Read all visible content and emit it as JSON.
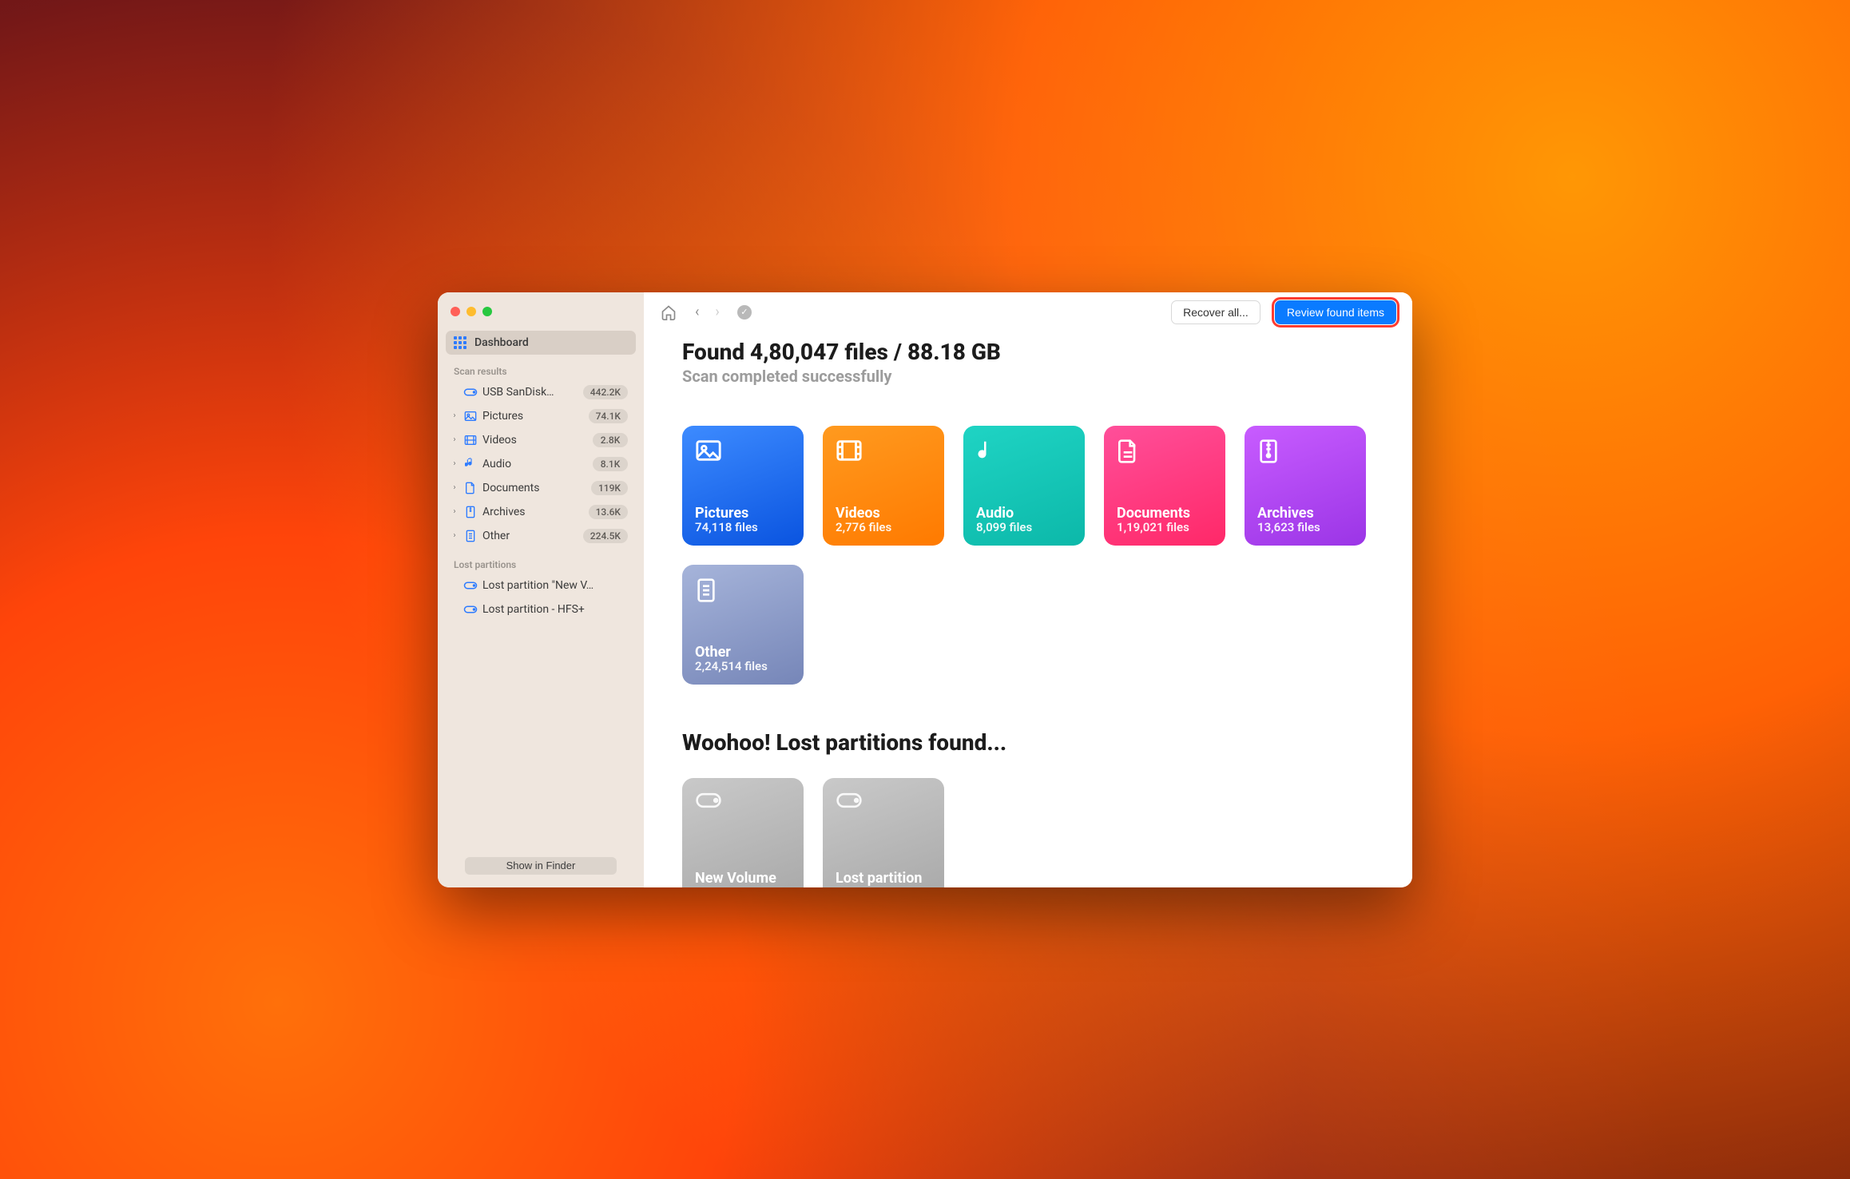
{
  "sidebar": {
    "dashboard_label": "Dashboard",
    "scan_results_header": "Scan results",
    "lost_partitions_header": "Lost partitions",
    "items": [
      {
        "label": "USB  SanDisk…",
        "count": "442.2K",
        "icon": "drive",
        "expandable": false,
        "indent": 0
      },
      {
        "label": "Pictures",
        "count": "74.1K",
        "icon": "image",
        "expandable": true,
        "indent": 0
      },
      {
        "label": "Videos",
        "count": "2.8K",
        "icon": "video",
        "expandable": true,
        "indent": 0
      },
      {
        "label": "Audio",
        "count": "8.1K",
        "icon": "audio",
        "expandable": true,
        "indent": 0
      },
      {
        "label": "Documents",
        "count": "119K",
        "icon": "doc",
        "expandable": true,
        "indent": 0
      },
      {
        "label": "Archives",
        "count": "13.6K",
        "icon": "archive",
        "expandable": true,
        "indent": 0
      },
      {
        "label": "Other",
        "count": "224.5K",
        "icon": "other",
        "expandable": true,
        "indent": 0
      }
    ],
    "lost_partitions": [
      {
        "label": "Lost partition \"New V…"
      },
      {
        "label": "Lost partition - HFS+"
      }
    ],
    "finder_button": "Show in Finder"
  },
  "toolbar": {
    "recover_all": "Recover all...",
    "review_found": "Review found items"
  },
  "summary": {
    "headline": "Found 4,80,047 files / 88.18 GB",
    "subhead": "Scan completed successfully"
  },
  "categories": [
    {
      "key": "pictures",
      "title": "Pictures",
      "sub": "74,118 files"
    },
    {
      "key": "videos",
      "title": "Videos",
      "sub": "2,776 files"
    },
    {
      "key": "audio",
      "title": "Audio",
      "sub": "8,099 files"
    },
    {
      "key": "documents",
      "title": "Documents",
      "sub": "1,19,021 files"
    },
    {
      "key": "archives",
      "title": "Archives",
      "sub": "13,623 files"
    },
    {
      "key": "other",
      "title": "Other",
      "sub": "2,24,514 files"
    }
  ],
  "partitions_section": {
    "title": "Woohoo! Lost partitions found...",
    "items": [
      {
        "title": "New Volume"
      },
      {
        "title": "Lost partition"
      }
    ]
  }
}
